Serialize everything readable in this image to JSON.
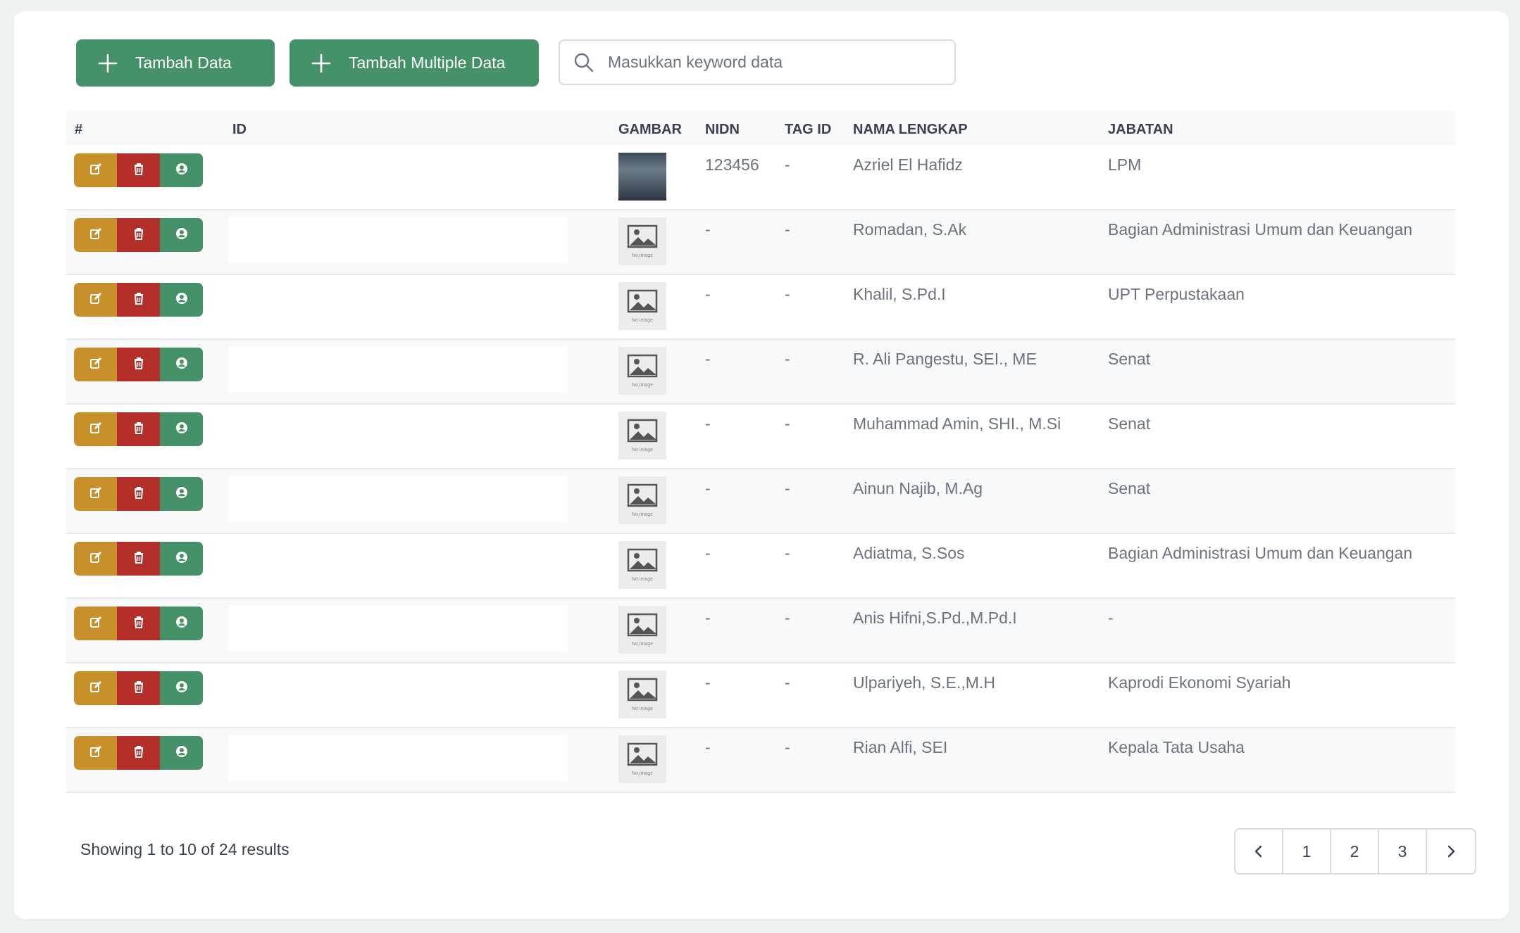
{
  "toolbar": {
    "add_label": "Tambah Data",
    "add_multi_label": "Tambah Multiple Data",
    "search_placeholder": "Masukkan keyword data"
  },
  "table": {
    "columns": [
      "#",
      "ID",
      "GAMBAR",
      "NIDN",
      "TAG ID",
      "NAMA LENGKAP",
      "JABATAN"
    ],
    "rows": [
      {
        "nidn": "123456",
        "tag": "-",
        "nama": "Azriel El Hafidz",
        "jabatan": "LPM",
        "image": "photo"
      },
      {
        "nidn": "-",
        "tag": "-",
        "nama": "Romadan, S.Ak",
        "jabatan": "Bagian Administrasi Umum dan Keuangan",
        "image": "no-image"
      },
      {
        "nidn": "-",
        "tag": "-",
        "nama": "Khalil, S.Pd.I",
        "jabatan": "UPT Perpustakaan",
        "image": "no-image"
      },
      {
        "nidn": "-",
        "tag": "-",
        "nama": "R. Ali Pangestu, SEI., ME",
        "jabatan": "Senat",
        "image": "no-image"
      },
      {
        "nidn": "-",
        "tag": "-",
        "nama": "Muhammad Amin, SHI., M.Si",
        "jabatan": "Senat",
        "image": "no-image"
      },
      {
        "nidn": "-",
        "tag": "-",
        "nama": "Ainun Najib, M.Ag",
        "jabatan": "Senat",
        "image": "no-image"
      },
      {
        "nidn": "-",
        "tag": "-",
        "nama": "Adiatma, S.Sos",
        "jabatan": "Bagian Administrasi Umum dan Keuangan",
        "image": "no-image"
      },
      {
        "nidn": "-",
        "tag": "-",
        "nama": "Anis Hifni,S.Pd.,M.Pd.I",
        "jabatan": "-",
        "image": "no-image"
      },
      {
        "nidn": "-",
        "tag": "-",
        "nama": "Ulpariyeh, S.E.,M.H",
        "jabatan": "Kaprodi Ekonomi Syariah",
        "image": "no-image"
      },
      {
        "nidn": "-",
        "tag": "-",
        "nama": "Rian Alfi, SEI",
        "jabatan": "Kepala Tata Usaha",
        "image": "no-image"
      }
    ],
    "no_image_text": "No image"
  },
  "footer": {
    "summary": "Showing 1 to 10 of 24 results",
    "pages": [
      "1",
      "2",
      "3"
    ]
  },
  "colors": {
    "green": "#45916a",
    "edit": "#c8902b",
    "delete": "#b52f2a"
  }
}
